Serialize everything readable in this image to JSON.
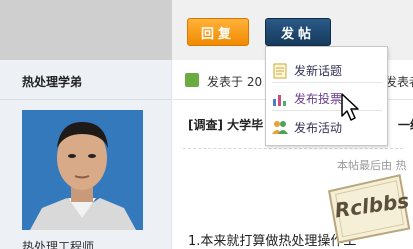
{
  "sidebar": {
    "username": "热处理学弟",
    "user_title": "热处理工程师"
  },
  "toolbar": {
    "reply_label": "回复",
    "post_label": "发帖"
  },
  "post_menu": {
    "items": [
      {
        "label": "发新话题",
        "icon": "new-topic-icon"
      },
      {
        "label": "发布投票",
        "icon": "poll-icon"
      },
      {
        "label": "发布活动",
        "icon": "activity-icon"
      }
    ]
  },
  "post": {
    "posted_prefix": "发表于 20",
    "author_fragment": "发表者",
    "title": "[调查] 大学毕",
    "title_tail": "一级",
    "last_edit": "本帖最后由 热",
    "body_start": "1.本来就打算做热处理操作工"
  },
  "watermark": {
    "text": "Rclbbs"
  },
  "colors": {
    "reply_button": "#f08a00",
    "post_button": "#163a5d",
    "sidebar_bg": "#edf1f5"
  }
}
